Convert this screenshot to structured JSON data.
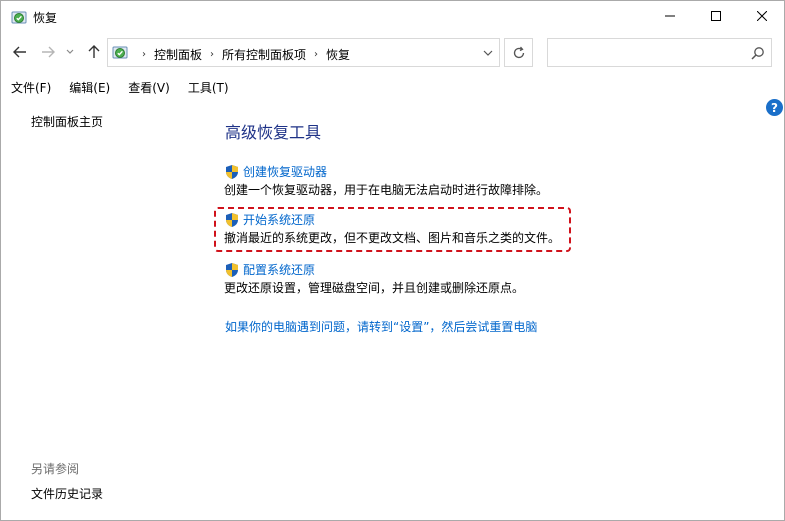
{
  "window": {
    "title": "恢复"
  },
  "address": {
    "crumbs": [
      "控制面板",
      "所有控制面板项",
      "恢复"
    ],
    "sep": "›"
  },
  "search": {
    "placeholder": ""
  },
  "menu": {
    "items": [
      "文件(F)",
      "编辑(E)",
      "查看(V)",
      "工具(T)"
    ]
  },
  "left": {
    "home": "控制面板主页",
    "see_also": "另请参阅",
    "file_history": "文件历史记录"
  },
  "main": {
    "heading": "高级恢复工具",
    "tasks": [
      {
        "link": "创建恢复驱动器",
        "desc": "创建一个恢复驱动器，用于在电脑无法启动时进行故障排除。"
      },
      {
        "link": "开始系统还原",
        "desc": "撤消最近的系统更改，但不更改文档、图片和音乐之类的文件。"
      },
      {
        "link": "配置系统还原",
        "desc": "更改还原设置，管理磁盘空间，并且创建或删除还原点。"
      }
    ],
    "reset_link": "如果你的电脑遇到问题，请转到“设置”，然后尝试重置电脑"
  },
  "help": {
    "label": "?"
  },
  "colors": {
    "link": "#0066cc",
    "heading": "#1e3287",
    "highlight": "#d0121b"
  }
}
